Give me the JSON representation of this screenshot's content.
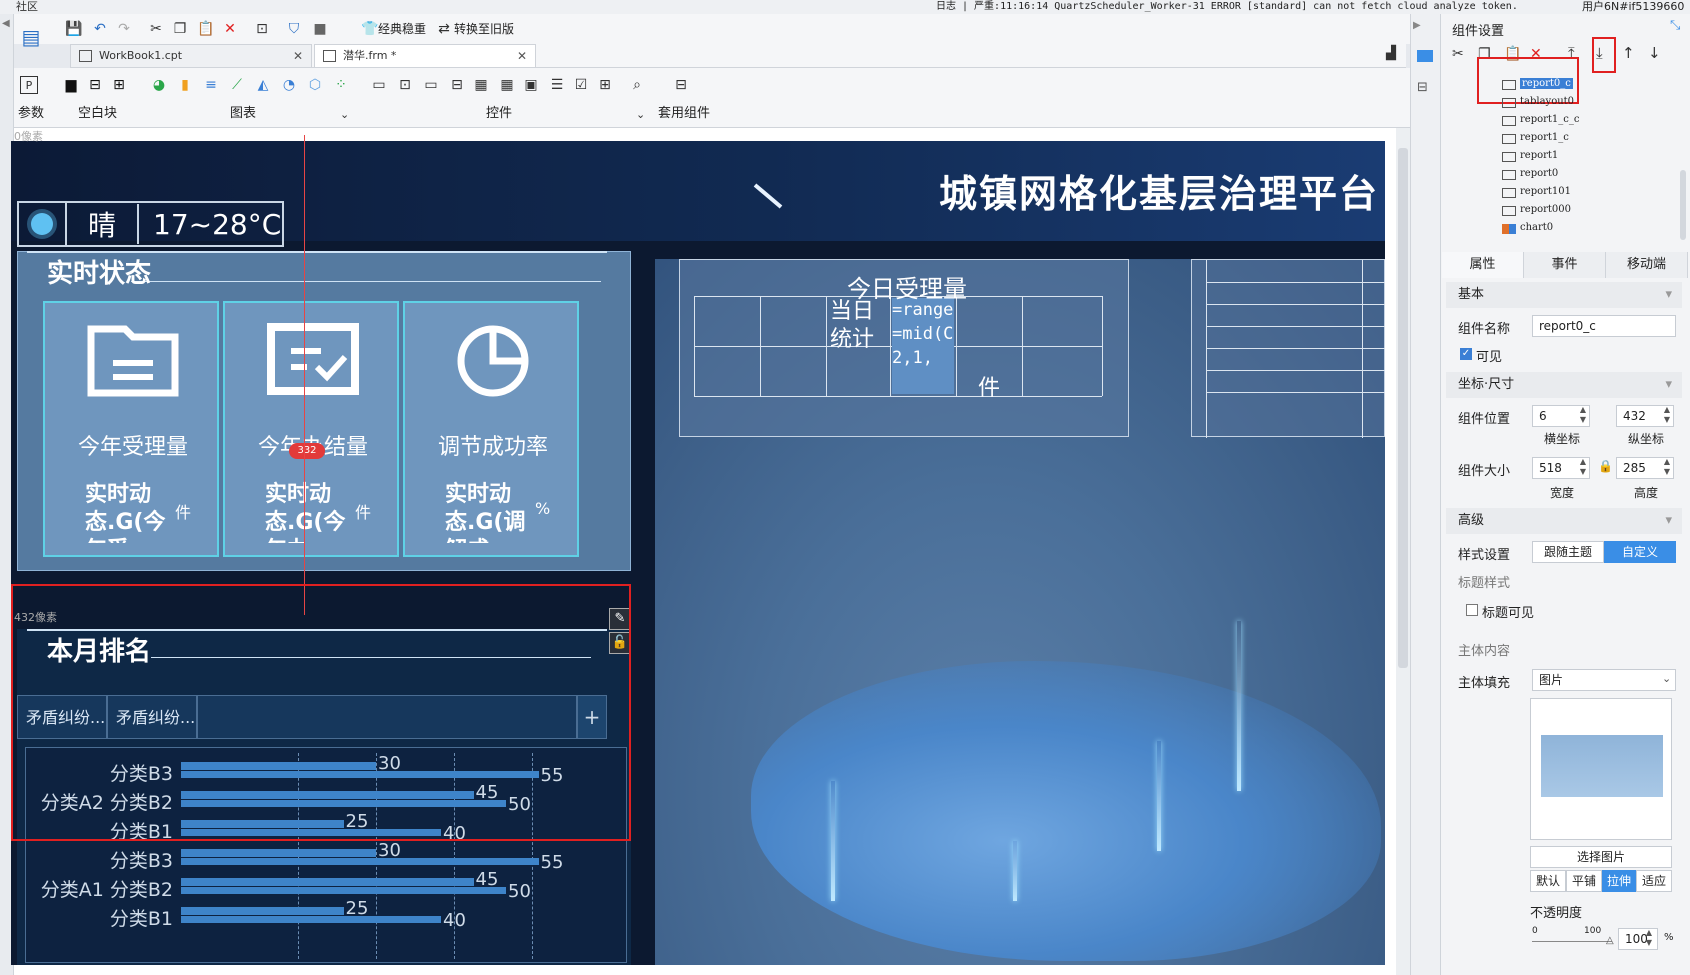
{
  "topbar": {
    "left_label": "社区",
    "log": "日志 | 严重:11:16:14 QuartzScheduler_Worker-31 ERROR [standard] can not fetch cloud analyze token.",
    "user": "用户6N#if5139660"
  },
  "toolbar": {
    "classic_label": "经典稳重",
    "convert_label": "转换至旧版"
  },
  "tabs": [
    {
      "label": "WorkBook1.cpt"
    },
    {
      "label": "潜华.frm *"
    }
  ],
  "ribbon": {
    "params": "参数",
    "blank": "空白块",
    "chart": "图表",
    "widget": "控件",
    "apply": "套用组件"
  },
  "canvas": {
    "px_top": "0像素",
    "px_mid": "432像素"
  },
  "design": {
    "title": "城镇网格化基层治理平台",
    "weather": {
      "desc": "晴",
      "temp": "17~28°C"
    },
    "realtime": {
      "title": "实时状态",
      "cards": [
        {
          "label": "今年受理量",
          "value": "实时动态.G(今年受",
          "unit": "件"
        },
        {
          "label": "今年办结量",
          "value": "实时动态.G(今年办",
          "unit": "件"
        },
        {
          "label": "调节成功率",
          "value": "实时动态.G(调解成",
          "unit": "%"
        }
      ],
      "badge": "332"
    },
    "today": {
      "title": "今日受理量",
      "cell_label": "当日统计",
      "formula": "=range =mid(C2,1,",
      "unit": "件"
    },
    "ranking": {
      "title": "本月排名",
      "tabs": [
        "矛盾纠纷...",
        "矛盾纠纷..."
      ]
    }
  },
  "chart_data": {
    "type": "bar",
    "orientation": "horizontal",
    "categories": [
      "分类B3",
      "分类A2 分类B2",
      "分类B1",
      "分类B3",
      "分类A1 分类B2",
      "分类B1"
    ],
    "series": [
      {
        "values": [
          30,
          45,
          25,
          30,
          45,
          25
        ]
      },
      {
        "values": [
          55,
          50,
          40,
          55,
          50,
          40
        ]
      }
    ],
    "xlim": [
      0,
      60
    ]
  },
  "rpanel": {
    "title": "组件设置",
    "tree": [
      "report0_c",
      "tablayout0",
      "report1_c_c",
      "report1_c",
      "report1",
      "report0",
      "report101",
      "report000",
      "chart0"
    ],
    "tabs": [
      "属性",
      "事件",
      "移动端"
    ],
    "basic": "基本",
    "name_label": "组件名称",
    "name_value": "report0_c",
    "visible_label": "可见",
    "pos_section": "坐标·尺寸",
    "pos_label": "组件位置",
    "pos_x": "6",
    "pos_y": "432",
    "x_label": "横坐标",
    "y_label": "纵坐标",
    "size_label": "组件大小",
    "width": "518",
    "height": "285",
    "w_label": "宽度",
    "h_label": "高度",
    "advanced": "高级",
    "style_label": "样式设置",
    "style_theme": "跟随主题",
    "style_custom": "自定义",
    "title_style": "标题样式",
    "title_visible": "标题可见",
    "body": "主体内容",
    "fill_label": "主体填充",
    "fill_value": "图片",
    "choose_image": "选择图片",
    "modes": [
      "默认",
      "平铺",
      "拉伸",
      "适应"
    ],
    "opacity_label": "不透明度",
    "slider_min": "0",
    "slider_max": "100",
    "opacity_value": "100",
    "percent": "%"
  }
}
